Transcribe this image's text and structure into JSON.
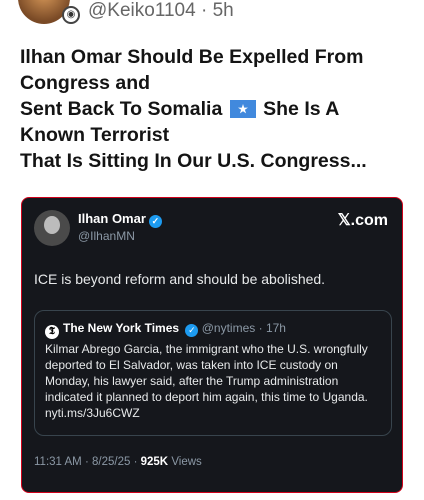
{
  "post": {
    "handle": "@Keiko1104",
    "separator": "·",
    "age": "5h",
    "headline_lines": [
      "Ilhan Omar Should Be Expelled From",
      "Congress and",
      "Sent Back To Somalia",
      "She Is A",
      "Known Terrorist",
      "That Is Sitting In Our U.S. Congress..."
    ]
  },
  "embedded": {
    "name": "Ilhan Omar",
    "handle": "@IlhanMN",
    "brand": "𝕏.com",
    "text": "ICE is beyond reform and should be abolished.",
    "quote": {
      "name": "The New York Times",
      "handle": "@nytimes",
      "age": "17h",
      "body": "Kilmar Abrego Garcia, the immigrant who the U.S. wrongfully deported to El Salvador, was taken into ICE custody on Monday, his lawyer said, after the Trump administration indicated it planned to deport him again, this time to Uganda. nyti.ms/3Ju6CWZ"
    },
    "time": "11:31 AM",
    "date": "8/25/25",
    "views_count": "925K",
    "views_label": "Views"
  },
  "colors": {
    "card_bg": "#15171c",
    "card_border": "#d0021b",
    "verified": "#1d9bf0",
    "flag": "#4189dd"
  }
}
